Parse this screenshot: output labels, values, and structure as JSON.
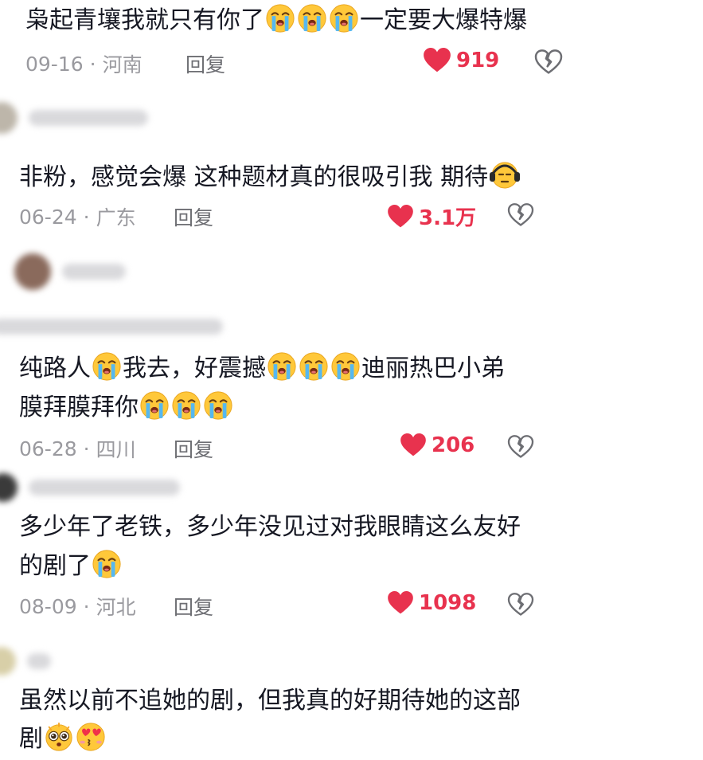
{
  "comments": [
    {
      "text_parts": [
        "枭起青壤我就只有你了",
        "",
        "",
        "",
        "一定要大爆特爆"
      ],
      "date": "09-16",
      "region": "河南",
      "reply": "回复",
      "likes": "919"
    },
    {
      "text_parts": [
        "非粉，感觉会爆 这种题材真的很吸引我 期待"
      ],
      "date": "06-24",
      "region": "广东",
      "reply": "回复",
      "likes": "3.1万"
    },
    {
      "line1_parts": [
        "纯路人",
        "我去，好震撼",
        "迪丽热巴小弟"
      ],
      "line2_parts": [
        "膜拜膜拜你"
      ],
      "date": "06-28",
      "region": "四川",
      "reply": "回复",
      "likes": "206"
    },
    {
      "line1": "多少年了老铁，多少年没见过对我眼睛这么友好",
      "line2": "的剧了",
      "date": "08-09",
      "region": "河北",
      "reply": "回复",
      "likes": "1098"
    },
    {
      "line1": "虽然以前不追她的剧，但我真的好期待她的这部",
      "line2": "剧"
    }
  ],
  "separator": "·",
  "icons": {
    "like": "heart-filled-icon",
    "dislike": "broken-heart-icon",
    "emoji_cry": "loudly-crying-face-emoji",
    "emoji_headphone": "headphone-face-emoji",
    "emoji_starstruck": "pleading-face-emoji",
    "emoji_heart_eyes": "heart-eyes-kiss-emoji"
  },
  "colors": {
    "like": "#e8324e",
    "text": "#161823",
    "meta": "#9a9a9f",
    "reply": "#6d6e73"
  }
}
